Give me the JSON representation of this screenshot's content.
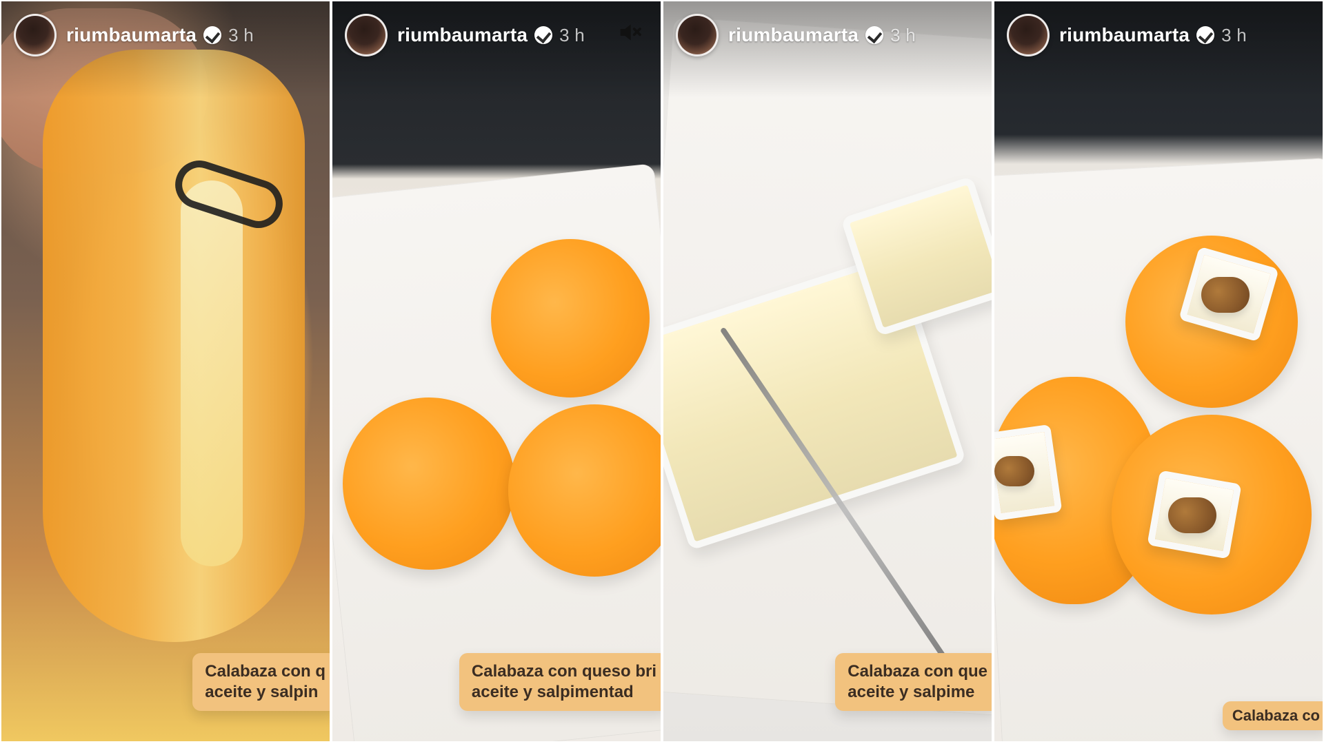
{
  "stories": [
    {
      "username": "riumbaumarta",
      "time": "3 h",
      "caption_lines": [
        "Calabaza con q",
        "aceite y salpin"
      ]
    },
    {
      "username": "riumbaumarta",
      "time": "3 h",
      "mute_icon": "speaker-muted-icon",
      "caption_lines": [
        "Calabaza con queso bri",
        "aceite y salpimentad"
      ]
    },
    {
      "username": "riumbaumarta",
      "time": "3 h",
      "caption_lines": [
        "Calabaza con que",
        "aceite y salpime"
      ]
    },
    {
      "username": "riumbaumarta",
      "time": "3 h",
      "caption_lines": [
        "Calabaza co"
      ]
    }
  ],
  "icons": {
    "verified_badge": "verified-badge-icon"
  }
}
